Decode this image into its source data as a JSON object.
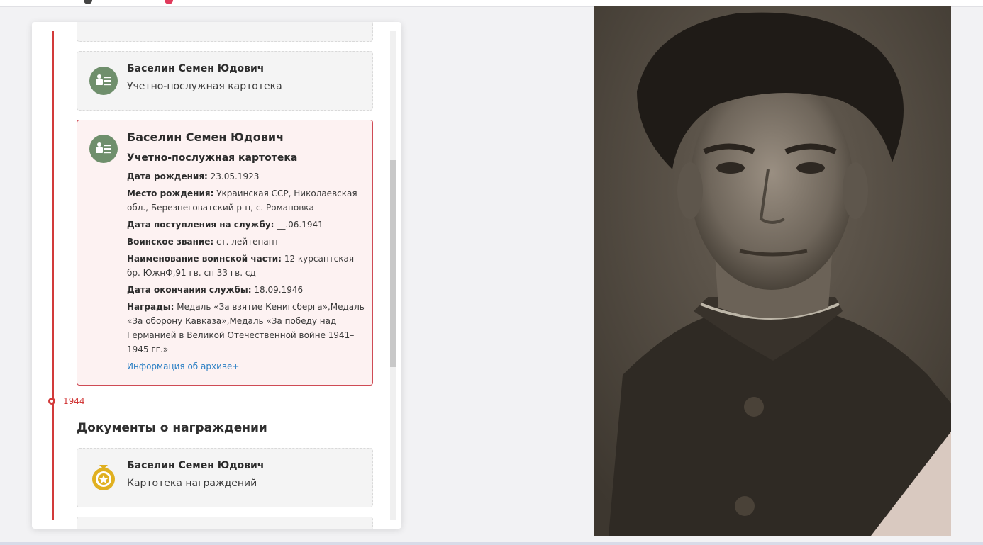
{
  "timeline": {
    "year_label": "1944"
  },
  "cards": [
    {
      "name": "Баселин Семен Юдович",
      "type": "Учетно-послужная картотека"
    },
    {
      "name": "Баселин Семен Юдович",
      "type": "Учетно-послужная картотека",
      "details": {
        "birth_date_label": "Дата рождения:",
        "birth_date_value": "23.05.1923",
        "birth_place_label": "Место рождения:",
        "birth_place_value": "Украинская ССР, Николаевская обл., Березнеговатский р-н, с. Романовка",
        "service_start_label": "Дата поступления на службу:",
        "service_start_value": "__.06.1941",
        "rank_label": "Воинское звание:",
        "rank_value": "ст. лейтенант",
        "unit_label": "Наименование воинской части:",
        "unit_value": "12 курсантская бр. ЮжнФ,91 гв. сп 33 гв. сд",
        "service_end_label": "Дата окончания службы:",
        "service_end_value": "18.09.1946",
        "awards_label": "Награды:",
        "awards_value": "Медаль «За взятие Кенигсберга»,Медаль «За оборону Кавказа»,Медаль «За победу над Германией в Великой Отечественной войне 1941–1945 гг.»"
      },
      "archive_link": "Информация об архиве+"
    },
    {
      "name": "Баселин Семен Юдович",
      "type": "Картотека награждений"
    }
  ],
  "section_title": "Документы о награждении",
  "icons": {
    "card_icon": "personnel-file-icon",
    "award_icon": "medal-icon"
  },
  "colors": {
    "accent_red": "#d23a3a",
    "highlight_border": "#cf4b55",
    "icon_green": "#6f8f6c",
    "medal_gold": "#e0b020",
    "link_blue": "#2b7fc4"
  }
}
